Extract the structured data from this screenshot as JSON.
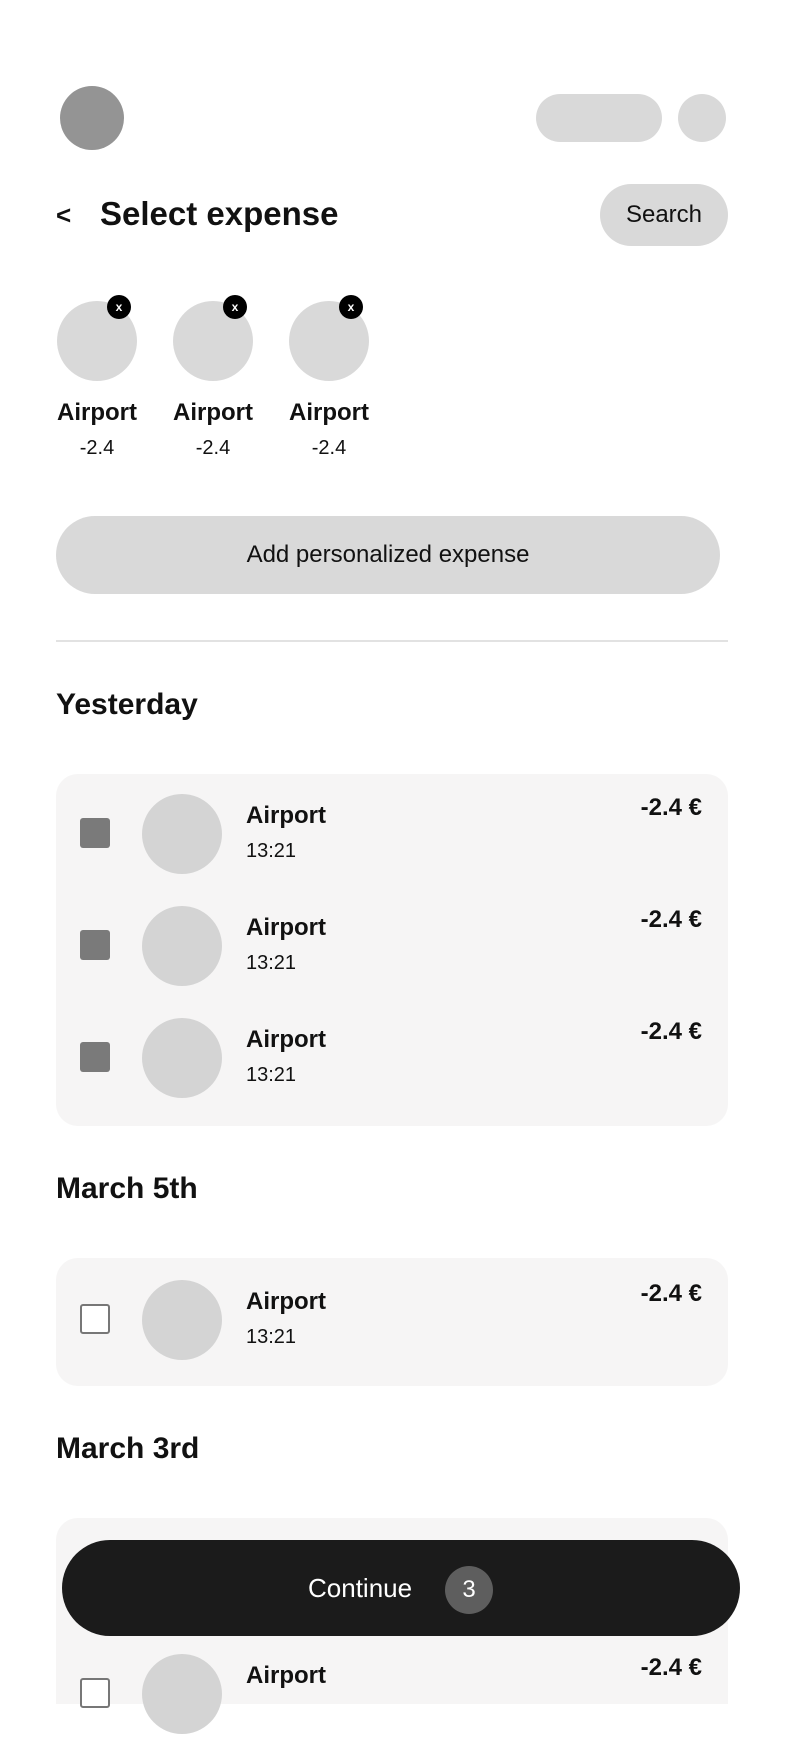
{
  "header": {
    "back_label": "<",
    "title": "Select expense",
    "search_label": "Search"
  },
  "selected": [
    {
      "name": "Airport",
      "amount": "-2.4",
      "remove_label": "x"
    },
    {
      "name": "Airport",
      "amount": "-2.4",
      "remove_label": "x"
    },
    {
      "name": "Airport",
      "amount": "-2.4",
      "remove_label": "x"
    }
  ],
  "add_button": {
    "label": "Add personalized expense"
  },
  "sections": [
    {
      "title": "Yesterday",
      "items": [
        {
          "name": "Airport",
          "time": "13:21",
          "amount": "-2.4 €",
          "checked": true
        },
        {
          "name": "Airport",
          "time": "13:21",
          "amount": "-2.4 €",
          "checked": true
        },
        {
          "name": "Airport",
          "time": "13:21",
          "amount": "-2.4 €",
          "checked": true
        }
      ]
    },
    {
      "title": "March 5th",
      "items": [
        {
          "name": "Airport",
          "time": "13:21",
          "amount": "-2.4 €",
          "checked": false
        }
      ]
    },
    {
      "title": "March 3rd",
      "items": [
        {
          "name": "Airport",
          "time": "",
          "amount": "-2.4 €",
          "checked": false
        }
      ]
    }
  ],
  "continue_button": {
    "label": "Continue",
    "count": "3"
  },
  "colors": {
    "placeholder": "#d9d9d9",
    "avatar": "#949494",
    "card_bg": "#f6f5f5",
    "checkbox_checked": "#7a7a7a",
    "primary_button": "#1b1b1b",
    "badge": "#5e5e5e"
  }
}
